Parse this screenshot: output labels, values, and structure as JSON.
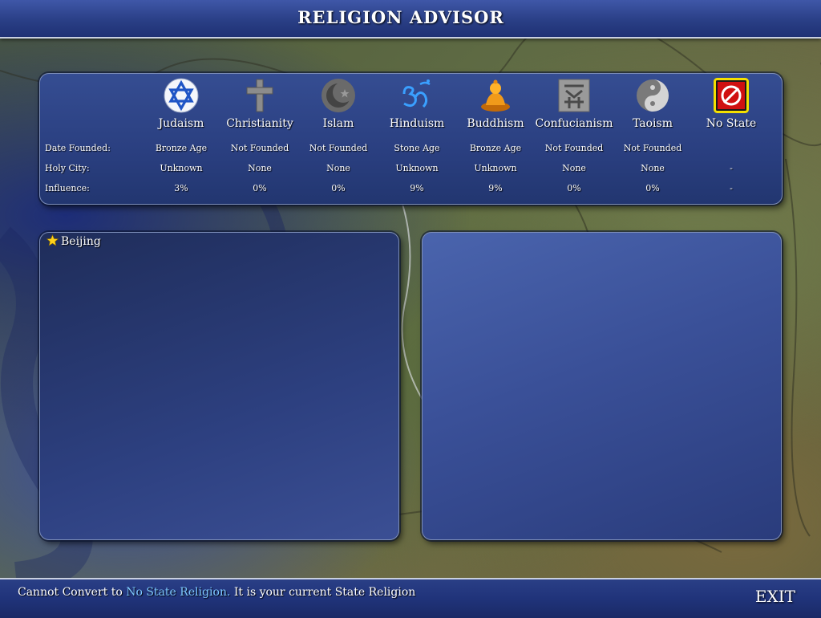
{
  "header": {
    "title": "RELIGION ADVISOR"
  },
  "table": {
    "row_labels": {
      "date_founded": "Date Founded:",
      "holy_city": "Holy City:",
      "influence": "Influence:"
    },
    "religions": [
      {
        "name": "Judaism",
        "icon": "star-of-david-icon",
        "date_founded": "Bronze Age",
        "holy_city": "Unknown",
        "influence": "3%"
      },
      {
        "name": "Christianity",
        "icon": "cross-icon",
        "date_founded": "Not Founded",
        "holy_city": "None",
        "influence": "0%"
      },
      {
        "name": "Islam",
        "icon": "crescent-icon",
        "date_founded": "Not Founded",
        "holy_city": "None",
        "influence": "0%"
      },
      {
        "name": "Hinduism",
        "icon": "om-icon",
        "date_founded": "Stone Age",
        "holy_city": "Unknown",
        "influence": "9%"
      },
      {
        "name": "Buddhism",
        "icon": "buddha-icon",
        "date_founded": "Bronze Age",
        "holy_city": "Unknown",
        "influence": "9%"
      },
      {
        "name": "Confucianism",
        "icon": "confucian-icon",
        "date_founded": "Not Founded",
        "holy_city": "None",
        "influence": "0%"
      },
      {
        "name": "Taoism",
        "icon": "yin-yang-icon",
        "date_founded": "Not Founded",
        "holy_city": "None",
        "influence": "0%"
      },
      {
        "name": "No State",
        "icon": "no-state-icon",
        "date_founded": "",
        "holy_city": "-",
        "influence": "-"
      }
    ]
  },
  "cities": [
    {
      "name": "Beijing",
      "icon": "capital-star-icon"
    }
  ],
  "footer": {
    "status_prefix": "Cannot Convert to ",
    "status_highlight": "No State Religion.",
    "status_suffix": " It is your current State Religion",
    "exit_label": "EXIT"
  },
  "colors": {
    "highlight_text": "#7ec8ff",
    "selected_border": "#f4e000"
  }
}
